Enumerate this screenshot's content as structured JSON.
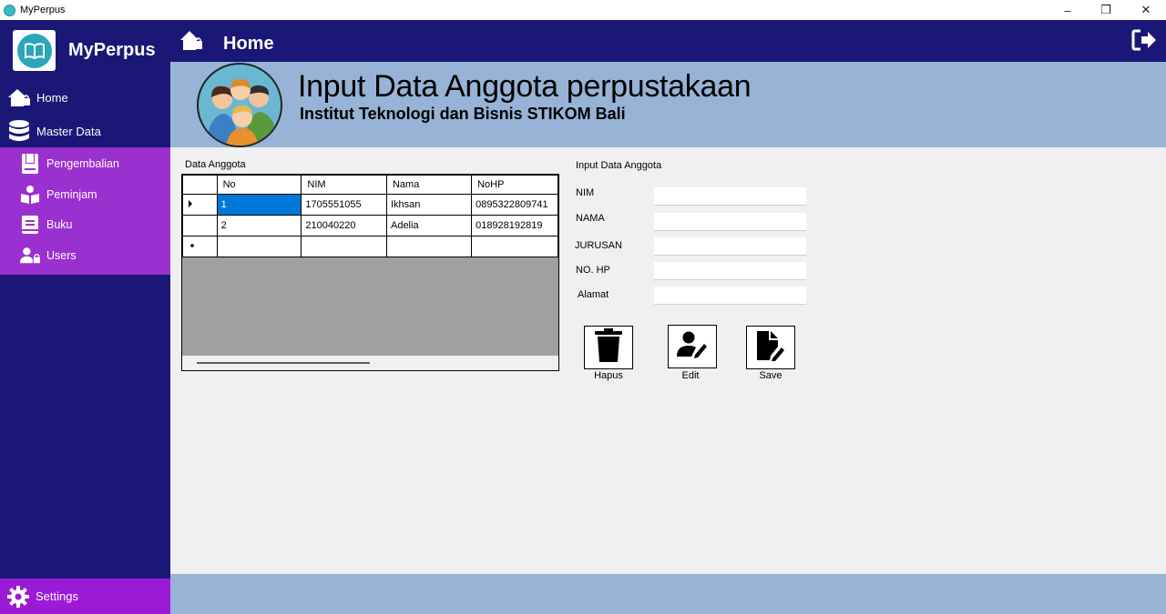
{
  "window": {
    "title": "MyPerpus",
    "minimize": "–",
    "restore": "❐",
    "close": "✕"
  },
  "sidebar": {
    "brand": "MyPerpus",
    "items": [
      {
        "label": "Home",
        "icon": "home-icon"
      },
      {
        "label": "Master Data",
        "icon": "database-icon"
      }
    ],
    "submenu": [
      {
        "label": "Pengembalian",
        "icon": "book-return-icon"
      },
      {
        "label": "Peminjam",
        "icon": "reader-icon"
      },
      {
        "label": "Buku",
        "icon": "book-icon"
      },
      {
        "label": "Users",
        "icon": "users-icon"
      }
    ],
    "settings": "Settings"
  },
  "header": {
    "title": "Home"
  },
  "banner": {
    "headline": "Input Data Anggota perpustakaan",
    "subline": "Institut Teknologi dan Bisnis STIKOM Bali"
  },
  "table": {
    "caption": "Data Anggota",
    "columns": [
      "No",
      "NIM",
      "Nama",
      "NoHP"
    ],
    "rows": [
      {
        "no": "1",
        "nim": "1705551055",
        "nama": "Ikhsan",
        "nohp": "0895322809741"
      },
      {
        "no": "2",
        "nim": "210040220",
        "nama": "Adelia",
        "nohp": "018928192819"
      }
    ]
  },
  "form": {
    "caption": "Input Data Anggota",
    "fields": [
      {
        "label": "NIM",
        "value": ""
      },
      {
        "label": "NAMA",
        "value": ""
      },
      {
        "label": "JURUSAN",
        "value": ""
      },
      {
        "label": "NO. HP",
        "value": ""
      },
      {
        "label": "Alamat",
        "value": ""
      }
    ],
    "buttons": [
      {
        "label": "Hapus",
        "icon": "trash-icon"
      },
      {
        "label": "Edit",
        "icon": "user-edit-icon"
      },
      {
        "label": "Save",
        "icon": "file-edit-icon"
      }
    ]
  },
  "colors": {
    "sidebar": "#1b1777",
    "submenu": "#9b30d0",
    "banner": "#97b3d5",
    "selection": "#0078d7"
  }
}
